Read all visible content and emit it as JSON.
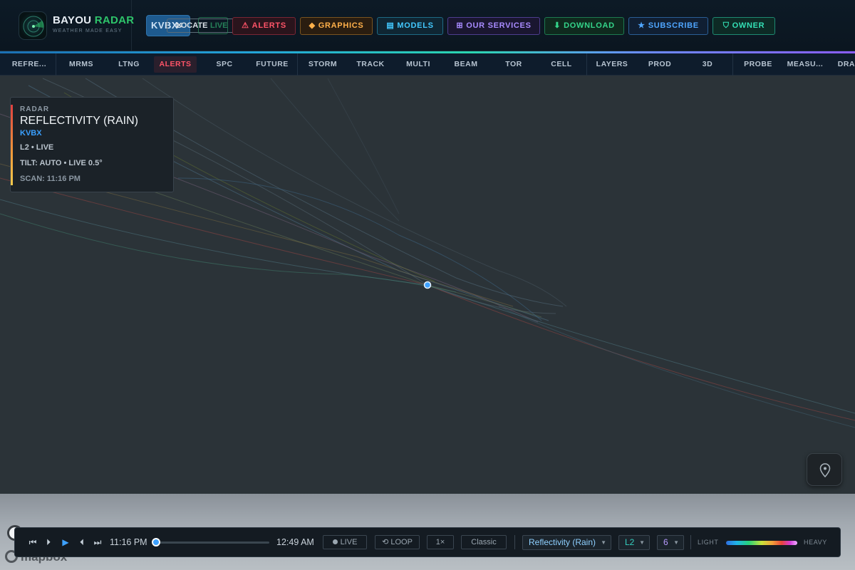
{
  "brand": {
    "name_part1": "BAYOU",
    "name_part2": "RADAR",
    "tagline": "WEATHER MADE EASY"
  },
  "header": {
    "station": "KVBX",
    "locate_label": "LOCATE",
    "live_label": "LIVE",
    "nav": [
      {
        "label": "ALERTS",
        "icon": "warning-icon",
        "glyph": "⚠"
      },
      {
        "label": "GRAPHICS",
        "icon": "diamond-icon",
        "glyph": "◆"
      },
      {
        "label": "MODELS",
        "icon": "list-icon",
        "glyph": "▤"
      },
      {
        "label": "OUR SERVICES",
        "icon": "grid-icon",
        "glyph": "⊞"
      },
      {
        "label": "DOWNLOAD",
        "icon": "download-icon",
        "glyph": "⬇"
      },
      {
        "label": "SUBSCRIBE",
        "icon": "star-icon",
        "glyph": "★"
      },
      {
        "label": "OWNER",
        "icon": "shield-icon",
        "glyph": "🛡"
      }
    ]
  },
  "toolbar": {
    "items": [
      "REFRE...",
      "MRMS",
      "LTNG",
      "ALERTS",
      "SPC",
      "FUTURE",
      "STORM",
      "TRACK",
      "MULTI",
      "BEAM",
      "TOR",
      "CELL",
      "LAYERS",
      "PROD",
      "3D",
      "PROBE",
      "MEASU...",
      "DRA"
    ],
    "active": "ALERTS"
  },
  "info_panel": {
    "label": "RADAR",
    "product": "REFLECTIVITY (RAIN)",
    "station": "KVBX",
    "level_status": "L2 • LIVE",
    "tilt": "TILT: AUTO • LIVE 0.5°",
    "scan": "SCAN: 11:16 PM"
  },
  "map": {
    "attribution": "mapbox",
    "background": "#2b3338",
    "station_marker_color": "#3ea1ff"
  },
  "playback": {
    "start_time": "11:16 PM",
    "end_time": "12:49 AM",
    "position": 0,
    "live_label": "LIVE",
    "loop_label": "LOOP",
    "speed": "1×",
    "style": "Classic",
    "product": "Reflectivity (Rain)",
    "level": "L2",
    "frames": "6",
    "legend_light": "LIGHT",
    "legend_heavy": "HEAVY"
  },
  "colors": {
    "accent_blue": "#3ea1ff",
    "alert_red": "#ff5468",
    "brand_green": "#2ec46a"
  }
}
